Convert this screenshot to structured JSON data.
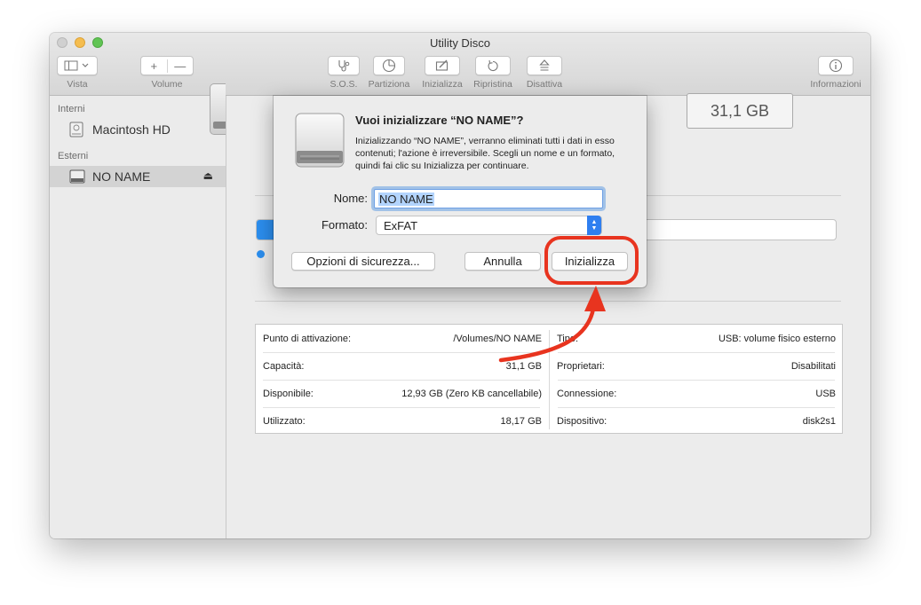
{
  "window": {
    "title": "Utility Disco"
  },
  "toolbar": {
    "view_label": "Vista",
    "volume_label": "Volume",
    "volume_add": "+",
    "volume_remove": "—",
    "sos_label": "S.O.S.",
    "partition_label": "Partiziona",
    "erase_label": "Inizializza",
    "restore_label": "Ripristina",
    "unmount_label": "Disattiva",
    "info_label": "Informazioni"
  },
  "sidebar": {
    "internal_header": "Interni",
    "external_header": "Esterni",
    "internal_items": [
      {
        "label": "Macintosh HD"
      }
    ],
    "external_items": [
      {
        "label": "NO NAME",
        "selected": true
      }
    ]
  },
  "main": {
    "capacity_display": "31,1 GB",
    "usage_fraction": 0.58,
    "info": [
      {
        "left_label": "Punto di attivazione:",
        "left_value": "/Volumes/NO NAME",
        "right_label": "Tipo:",
        "right_value": "USB: volume fisico esterno"
      },
      {
        "left_label": "Capacità:",
        "left_value": "31,1 GB",
        "right_label": "Proprietari:",
        "right_value": "Disabilitati"
      },
      {
        "left_label": "Disponibile:",
        "left_value": "12,93 GB (Zero KB cancellabile)",
        "right_label": "Connessione:",
        "right_value": "USB"
      },
      {
        "left_label": "Utilizzato:",
        "left_value": "18,17 GB",
        "right_label": "Dispositivo:",
        "right_value": "disk2s1"
      }
    ]
  },
  "dialog": {
    "title": "Vuoi inizializzare “NO NAME”?",
    "message": "Inizializzando “NO NAME”, verranno eliminati tutti i dati in esso contenuti; l'azione è irreversibile. Scegli un nome e un formato, quindi fai clic su Inizializza per continuare.",
    "name_label": "Nome:",
    "name_value": "NO NAME",
    "format_label": "Formato:",
    "format_value": "ExFAT",
    "security_button": "Opzioni di sicurezza...",
    "cancel_button": "Annulla",
    "erase_button": "Inizializza"
  },
  "colors": {
    "accent": "#2c8ff0",
    "annotation": "#e8341f"
  }
}
